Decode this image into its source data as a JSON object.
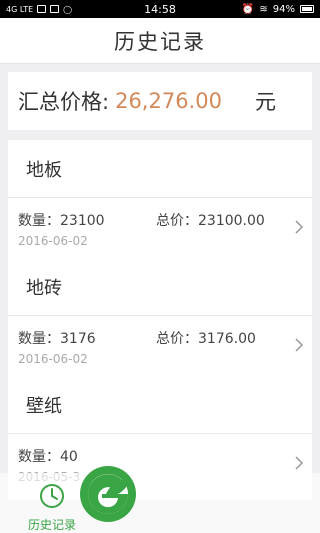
{
  "status_bar": {
    "left_text": "4G LTE",
    "time": "14:58",
    "battery": "94%"
  },
  "nav": {
    "title": "历史记录"
  },
  "summary": {
    "label": "汇总价格:",
    "value": "26,276.00",
    "unit": "元"
  },
  "records": [
    {
      "category": "地板",
      "qty": "数量：23100",
      "total": "总价：23100.00",
      "date": "2016-06-02"
    },
    {
      "category": "地砖",
      "qty": "数量：3176",
      "total": "总价：3176.00",
      "date": "2016-06-02"
    },
    {
      "category": "壁纸",
      "qty": "数量：40",
      "total": "",
      "date": "2016-05-3"
    }
  ],
  "tab_bar": {
    "history_label": "历史记录"
  },
  "colors": {
    "accent_orange": "#d2895a",
    "brand_green": "#3aa544"
  },
  "icons": {
    "history_tab": "clock-icon",
    "logo": "leaf-logo-icon",
    "row_arrow": "chevron-right-icon"
  }
}
